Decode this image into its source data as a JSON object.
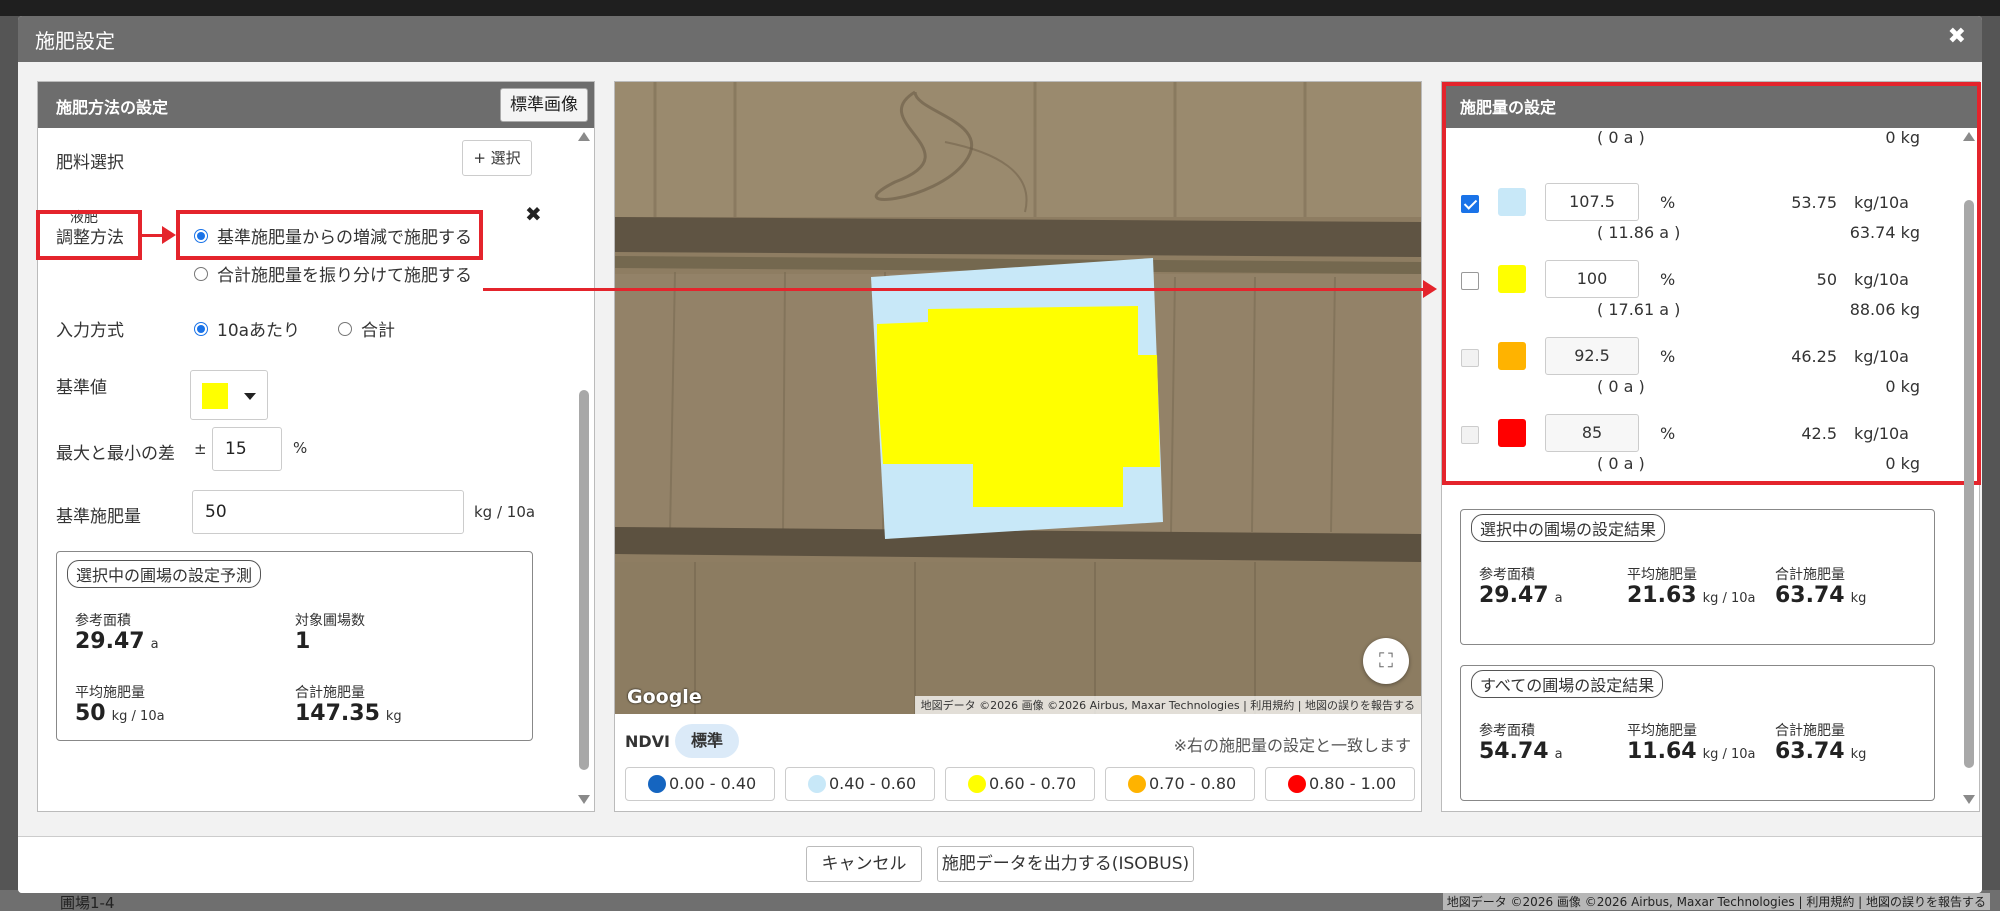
{
  "background": {
    "bottom_text": "圃場1-4",
    "bottom_credit": "地図データ ©2026 画像 ©2026 Airbus, Maxar Technologies | 利用規約 | 地図の誤りを報告する"
  },
  "modal": {
    "title": "施肥設定",
    "close_icon": "✖"
  },
  "left": {
    "title": "施肥方法の設定",
    "standard_image_button": "標準画像",
    "fertilizer_label": "肥料選択",
    "select_button": "+ 選択",
    "fertilizer_item": "液肥",
    "remove_icon": "✖",
    "adjust_label": "調整方法",
    "adjust_options": [
      "基準施肥量からの増減で施肥する",
      "合計施肥量を振り分けて施肥する"
    ],
    "input_label": "入力方式",
    "input_options": [
      "10aあたり",
      "合計"
    ],
    "base_value_label": "基準値",
    "base_value_color": "#ffff00",
    "diff_label": "最大と最小の差",
    "diff_prefix": "±",
    "diff_value": "15",
    "diff_unit": "%",
    "base_amount_label": "基準施肥量",
    "base_amount_value": "50",
    "base_amount_unit": "kg / 10a",
    "prediction": {
      "title": "選択中の圃場の設定予測",
      "area_label": "参考面積",
      "area_value": "29.47",
      "area_unit": "a",
      "count_label": "対象圃場数",
      "count_value": "1",
      "avg_label": "平均施肥量",
      "avg_value": "50",
      "avg_unit": "kg / 10a",
      "total_label": "合計施肥量",
      "total_value": "147.35",
      "total_unit": "kg"
    }
  },
  "map": {
    "google": "Google",
    "credit": "地図データ ©2026 画像 ©2026 Airbus, Maxar Technologies | 利用規約 | 地図の誤りを報告する",
    "ndvi_label": "NDVI",
    "ndvi_tag": "標準",
    "ndvi_note": "※右の施肥量の設定と一致します",
    "legend": [
      {
        "label": "0.00 - 0.40",
        "color": "#1565c0"
      },
      {
        "label": "0.40 - 0.60",
        "color": "#c8e8f8"
      },
      {
        "label": "0.60 - 0.70",
        "color": "#ffff00"
      },
      {
        "label": "0.70 - 0.80",
        "color": "#ffb300"
      },
      {
        "label": "0.80 - 1.00",
        "color": "#ff0000"
      }
    ]
  },
  "right": {
    "title": "施肥量の設定",
    "top_area": "( 0 a )",
    "top_kg": "0 kg",
    "rows": [
      {
        "checked": true,
        "color": "#c8e8f8",
        "pct": "107.5",
        "pct_unit": "%",
        "rate": "53.75",
        "rate_unit": "kg/10a",
        "area": "( 11.86 a )",
        "total": "63.74 kg"
      },
      {
        "checked": false,
        "color": "#ffff00",
        "pct": "100",
        "pct_unit": "%",
        "rate": "50",
        "rate_unit": "kg/10a",
        "area": "( 17.61 a )",
        "total": "88.06 kg"
      },
      {
        "checked": false,
        "color": "#ffb300",
        "pct": "92.5",
        "pct_unit": "%",
        "rate": "46.25",
        "rate_unit": "kg/10a",
        "area": "( 0 a )",
        "total": "0 kg"
      },
      {
        "checked": false,
        "color": "#ff0000",
        "pct": "85",
        "pct_unit": "%",
        "rate": "42.5",
        "rate_unit": "kg/10a",
        "area": "( 0 a )",
        "total": "0 kg"
      }
    ],
    "selected_result": {
      "title": "選択中の圃場の設定結果",
      "area_label": "参考面積",
      "area_value": "29.47",
      "area_unit": "a",
      "avg_label": "平均施肥量",
      "avg_value": "21.63",
      "avg_unit": "kg / 10a",
      "total_label": "合計施肥量",
      "total_value": "63.74",
      "total_unit": "kg"
    },
    "all_result": {
      "title": "すべての圃場の設定結果",
      "area_label": "参考面積",
      "area_value": "54.74",
      "area_unit": "a",
      "avg_label": "平均施肥量",
      "avg_value": "11.64",
      "avg_unit": "kg / 10a",
      "total_label": "合計施肥量",
      "total_value": "63.74",
      "total_unit": "kg"
    }
  },
  "footer": {
    "cancel": "キャンセル",
    "export": "施肥データを出力する(ISOBUS)"
  }
}
